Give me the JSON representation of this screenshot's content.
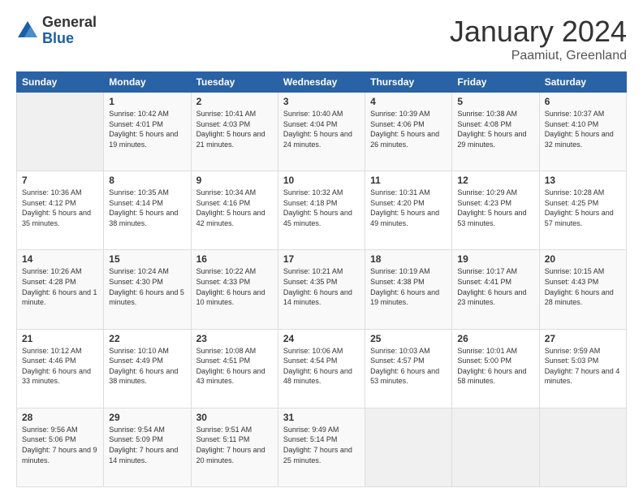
{
  "logo": {
    "general": "General",
    "blue": "Blue"
  },
  "title": "January 2024",
  "location": "Paamiut, Greenland",
  "days_header": [
    "Sunday",
    "Monday",
    "Tuesday",
    "Wednesday",
    "Thursday",
    "Friday",
    "Saturday"
  ],
  "weeks": [
    [
      {
        "num": "",
        "sunrise": "",
        "sunset": "",
        "daylight": "",
        "empty": true
      },
      {
        "num": "1",
        "sunrise": "Sunrise: 10:42 AM",
        "sunset": "Sunset: 4:01 PM",
        "daylight": "Daylight: 5 hours and 19 minutes."
      },
      {
        "num": "2",
        "sunrise": "Sunrise: 10:41 AM",
        "sunset": "Sunset: 4:03 PM",
        "daylight": "Daylight: 5 hours and 21 minutes."
      },
      {
        "num": "3",
        "sunrise": "Sunrise: 10:40 AM",
        "sunset": "Sunset: 4:04 PM",
        "daylight": "Daylight: 5 hours and 24 minutes."
      },
      {
        "num": "4",
        "sunrise": "Sunrise: 10:39 AM",
        "sunset": "Sunset: 4:06 PM",
        "daylight": "Daylight: 5 hours and 26 minutes."
      },
      {
        "num": "5",
        "sunrise": "Sunrise: 10:38 AM",
        "sunset": "Sunset: 4:08 PM",
        "daylight": "Daylight: 5 hours and 29 minutes."
      },
      {
        "num": "6",
        "sunrise": "Sunrise: 10:37 AM",
        "sunset": "Sunset: 4:10 PM",
        "daylight": "Daylight: 5 hours and 32 minutes."
      }
    ],
    [
      {
        "num": "7",
        "sunrise": "Sunrise: 10:36 AM",
        "sunset": "Sunset: 4:12 PM",
        "daylight": "Daylight: 5 hours and 35 minutes."
      },
      {
        "num": "8",
        "sunrise": "Sunrise: 10:35 AM",
        "sunset": "Sunset: 4:14 PM",
        "daylight": "Daylight: 5 hours and 38 minutes."
      },
      {
        "num": "9",
        "sunrise": "Sunrise: 10:34 AM",
        "sunset": "Sunset: 4:16 PM",
        "daylight": "Daylight: 5 hours and 42 minutes."
      },
      {
        "num": "10",
        "sunrise": "Sunrise: 10:32 AM",
        "sunset": "Sunset: 4:18 PM",
        "daylight": "Daylight: 5 hours and 45 minutes."
      },
      {
        "num": "11",
        "sunrise": "Sunrise: 10:31 AM",
        "sunset": "Sunset: 4:20 PM",
        "daylight": "Daylight: 5 hours and 49 minutes."
      },
      {
        "num": "12",
        "sunrise": "Sunrise: 10:29 AM",
        "sunset": "Sunset: 4:23 PM",
        "daylight": "Daylight: 5 hours and 53 minutes."
      },
      {
        "num": "13",
        "sunrise": "Sunrise: 10:28 AM",
        "sunset": "Sunset: 4:25 PM",
        "daylight": "Daylight: 5 hours and 57 minutes."
      }
    ],
    [
      {
        "num": "14",
        "sunrise": "Sunrise: 10:26 AM",
        "sunset": "Sunset: 4:28 PM",
        "daylight": "Daylight: 6 hours and 1 minute."
      },
      {
        "num": "15",
        "sunrise": "Sunrise: 10:24 AM",
        "sunset": "Sunset: 4:30 PM",
        "daylight": "Daylight: 6 hours and 5 minutes."
      },
      {
        "num": "16",
        "sunrise": "Sunrise: 10:22 AM",
        "sunset": "Sunset: 4:33 PM",
        "daylight": "Daylight: 6 hours and 10 minutes."
      },
      {
        "num": "17",
        "sunrise": "Sunrise: 10:21 AM",
        "sunset": "Sunset: 4:35 PM",
        "daylight": "Daylight: 6 hours and 14 minutes."
      },
      {
        "num": "18",
        "sunrise": "Sunrise: 10:19 AM",
        "sunset": "Sunset: 4:38 PM",
        "daylight": "Daylight: 6 hours and 19 minutes."
      },
      {
        "num": "19",
        "sunrise": "Sunrise: 10:17 AM",
        "sunset": "Sunset: 4:41 PM",
        "daylight": "Daylight: 6 hours and 23 minutes."
      },
      {
        "num": "20",
        "sunrise": "Sunrise: 10:15 AM",
        "sunset": "Sunset: 4:43 PM",
        "daylight": "Daylight: 6 hours and 28 minutes."
      }
    ],
    [
      {
        "num": "21",
        "sunrise": "Sunrise: 10:12 AM",
        "sunset": "Sunset: 4:46 PM",
        "daylight": "Daylight: 6 hours and 33 minutes."
      },
      {
        "num": "22",
        "sunrise": "Sunrise: 10:10 AM",
        "sunset": "Sunset: 4:49 PM",
        "daylight": "Daylight: 6 hours and 38 minutes."
      },
      {
        "num": "23",
        "sunrise": "Sunrise: 10:08 AM",
        "sunset": "Sunset: 4:51 PM",
        "daylight": "Daylight: 6 hours and 43 minutes."
      },
      {
        "num": "24",
        "sunrise": "Sunrise: 10:06 AM",
        "sunset": "Sunset: 4:54 PM",
        "daylight": "Daylight: 6 hours and 48 minutes."
      },
      {
        "num": "25",
        "sunrise": "Sunrise: 10:03 AM",
        "sunset": "Sunset: 4:57 PM",
        "daylight": "Daylight: 6 hours and 53 minutes."
      },
      {
        "num": "26",
        "sunrise": "Sunrise: 10:01 AM",
        "sunset": "Sunset: 5:00 PM",
        "daylight": "Daylight: 6 hours and 58 minutes."
      },
      {
        "num": "27",
        "sunrise": "Sunrise: 9:59 AM",
        "sunset": "Sunset: 5:03 PM",
        "daylight": "Daylight: 7 hours and 4 minutes."
      }
    ],
    [
      {
        "num": "28",
        "sunrise": "Sunrise: 9:56 AM",
        "sunset": "Sunset: 5:06 PM",
        "daylight": "Daylight: 7 hours and 9 minutes."
      },
      {
        "num": "29",
        "sunrise": "Sunrise: 9:54 AM",
        "sunset": "Sunset: 5:09 PM",
        "daylight": "Daylight: 7 hours and 14 minutes."
      },
      {
        "num": "30",
        "sunrise": "Sunrise: 9:51 AM",
        "sunset": "Sunset: 5:11 PM",
        "daylight": "Daylight: 7 hours and 20 minutes."
      },
      {
        "num": "31",
        "sunrise": "Sunrise: 9:49 AM",
        "sunset": "Sunset: 5:14 PM",
        "daylight": "Daylight: 7 hours and 25 minutes."
      },
      {
        "num": "",
        "sunrise": "",
        "sunset": "",
        "daylight": "",
        "empty": true
      },
      {
        "num": "",
        "sunrise": "",
        "sunset": "",
        "daylight": "",
        "empty": true
      },
      {
        "num": "",
        "sunrise": "",
        "sunset": "",
        "daylight": "",
        "empty": true
      }
    ]
  ]
}
